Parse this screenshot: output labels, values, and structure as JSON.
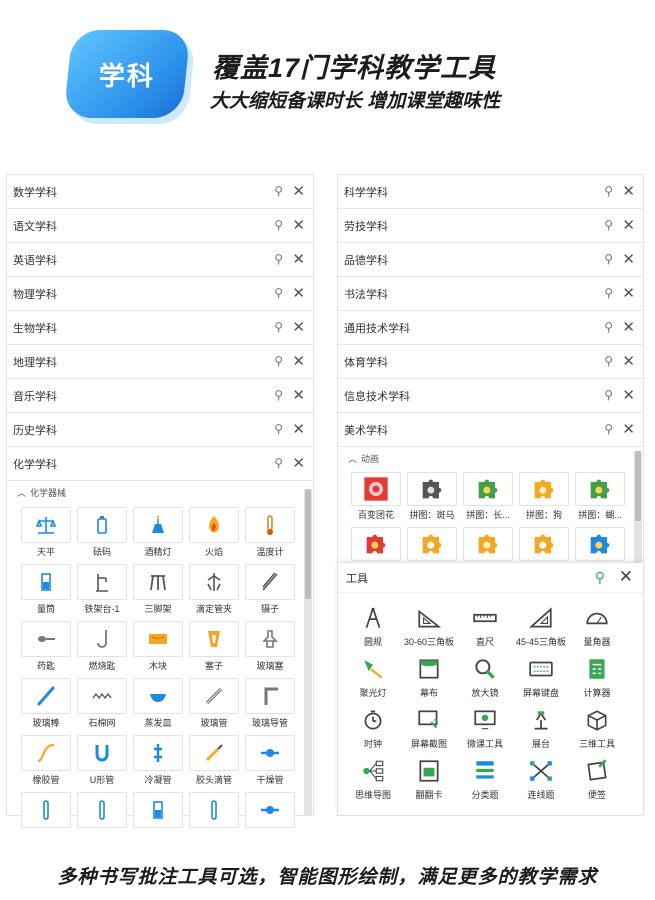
{
  "header": {
    "badge": "学科",
    "title": "覆盖17门学科教学工具",
    "subtitle": "大大缩短备课时长 增加课堂趣味性"
  },
  "footer": "多种书写批注工具可选，智能图形绘制，满足更多的教学需求",
  "left_subjects": [
    "数学学科",
    "语文学科",
    "英语学科",
    "物理学科",
    "生物学科",
    "地理学科",
    "音乐学科",
    "历史学科",
    "化学学科"
  ],
  "right_subjects": [
    "科学学科",
    "劳技学科",
    "品德学科",
    "书法学科",
    "通用技术学科",
    "体育学科",
    "信息技术学科",
    "美术学科"
  ],
  "chem_section": "化学器械",
  "chem_items": [
    "天平",
    "砝码",
    "酒精灯",
    "火焰",
    "温度计",
    "量筒",
    "铁架台-1",
    "三脚架",
    "滴定管夹",
    "镊子",
    "药匙",
    "燃烧匙",
    "木块",
    "塞子",
    "玻璃塞",
    "玻璃棒",
    "石棉网",
    "蒸发皿",
    "玻璃管",
    "玻璃导管",
    "橡胶管",
    "U形管",
    "冷凝管",
    "胶头滴管",
    "干燥管",
    "",
    "",
    "",
    "",
    ""
  ],
  "anim_section": "动画",
  "anim_items": [
    "百变团花",
    "拼图：斑马",
    "拼图：长...",
    "拼图：狗",
    "拼图：蝴..."
  ],
  "tools_title": "工具",
  "tools": [
    "圆规",
    "30-60三角板",
    "直尺",
    "45-45三角板",
    "量角器",
    "聚光灯",
    "幕布",
    "放大镜",
    "屏幕键盘",
    "计算器",
    "时钟",
    "屏幕截图",
    "微课工具",
    "展台",
    "三维工具",
    "思维导图",
    "翻翻卡",
    "分类题",
    "连线题",
    "便签"
  ],
  "colors": {
    "accent": "#2b8fea",
    "icon_blue": "#1e88e5",
    "icon_orange": "#f5a623",
    "icon_green": "#4caf50",
    "pin_green": "#36a852"
  }
}
